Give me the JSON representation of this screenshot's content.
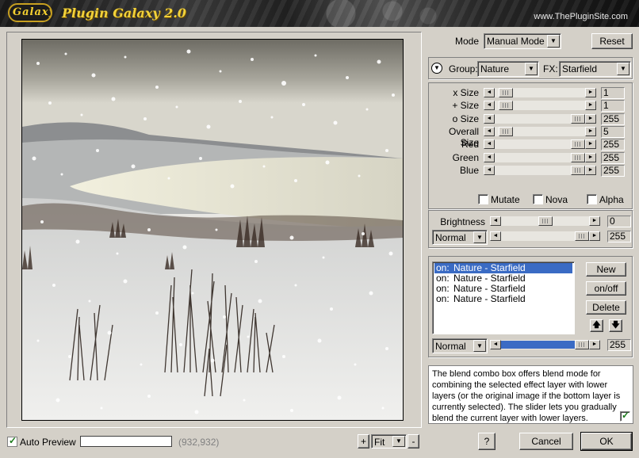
{
  "header": {
    "logo_text": "Galaxy",
    "title": "Plugin Galaxy 2.0",
    "site": "www.ThePluginSite.com"
  },
  "mode": {
    "label": "Mode",
    "value": "Manual Mode",
    "reset_label": "Reset"
  },
  "group": {
    "label": "Group:",
    "value": "Nature",
    "fx_label": "FX:",
    "fx_value": "Starfield"
  },
  "sliders": [
    {
      "label": "x Size",
      "value": "1",
      "level": 0.05
    },
    {
      "label": "+ Size",
      "value": "1",
      "level": 0.05
    },
    {
      "label": "o Size",
      "value": "255",
      "level": 1.0
    },
    {
      "label": "Overall Size",
      "value": "5",
      "level": 0.05
    },
    {
      "label": "Red",
      "value": "255",
      "level": 1.0
    },
    {
      "label": "Green",
      "value": "255",
      "level": 1.0
    },
    {
      "label": "Blue",
      "value": "255",
      "level": 1.0
    }
  ],
  "options": {
    "mutate": "Mutate",
    "nova": "Nova",
    "alpha": "Alpha"
  },
  "brightness": {
    "label": "Brightness",
    "value": "0",
    "level": 0.5
  },
  "blend": {
    "mode": "Normal",
    "value": "255",
    "level": 1.0
  },
  "layers": {
    "items": [
      {
        "state": "on:",
        "name": "Nature - Starfield",
        "selected": true
      },
      {
        "state": "on:",
        "name": "Nature - Starfield",
        "selected": false
      },
      {
        "state": "on:",
        "name": "Nature - Starfield",
        "selected": false
      },
      {
        "state": "on:",
        "name": "Nature - Starfield",
        "selected": false
      }
    ],
    "new_label": "New",
    "onoff_label": "on/off",
    "delete_label": "Delete",
    "blend_mode": "Normal",
    "blend_value": "255",
    "blend_level": 1.0
  },
  "help_text": "The blend combo box offers blend mode for combining the selected effect layer with lower layers (or the original image if the bottom layer is currently selected). The slider lets you gradually blend the current layer with lower layers.",
  "footer": {
    "auto_preview_label": "Auto Preview",
    "coords": "(932,932)",
    "zoom_in": "+",
    "zoom_value": "Fit",
    "zoom_out": "-",
    "help_button": "?",
    "cancel_label": "Cancel",
    "ok_label": "OK"
  }
}
